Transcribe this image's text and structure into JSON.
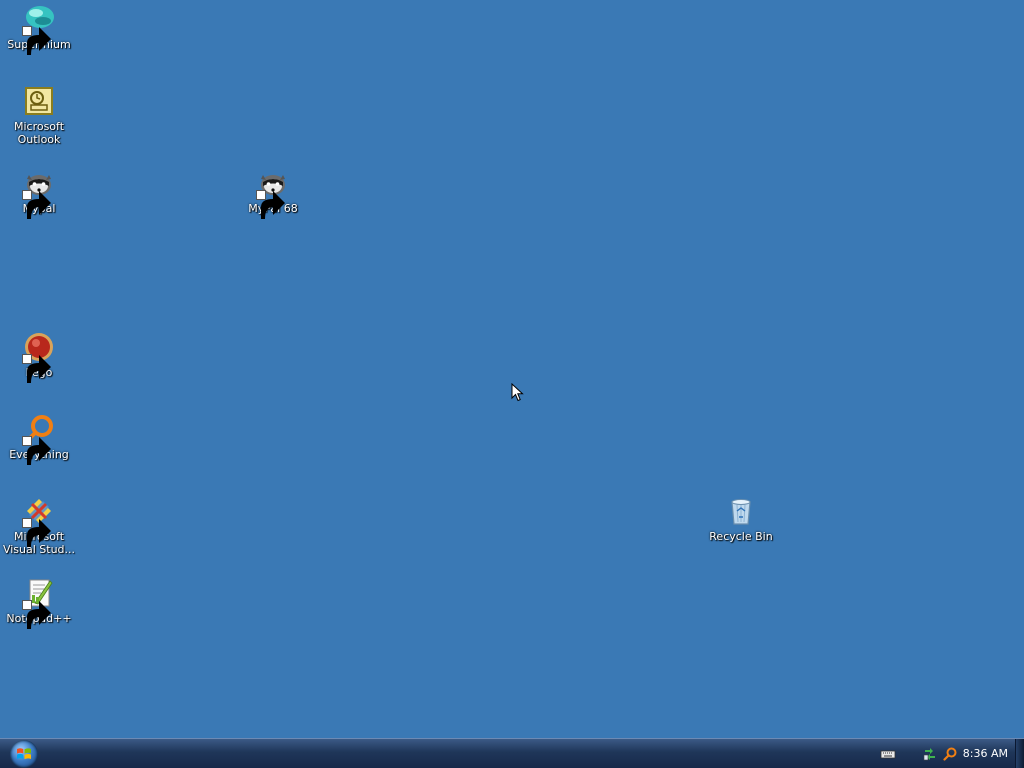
{
  "desktop": {
    "background_color": "#3a79b5",
    "icons": [
      {
        "label": "Supermium",
        "icon": "supermium-icon",
        "shortcut": true
      },
      {
        "label": "Microsoft\nOutlook",
        "icon": "outlook-icon",
        "shortcut": false
      },
      {
        "label": "Mypal",
        "icon": "mypal-icon",
        "shortcut": true
      },
      {
        "label": "MyPal 68",
        "icon": "mypal-icon",
        "shortcut": true
      },
      {
        "label": "Pego",
        "icon": "pego-icon",
        "shortcut": true
      },
      {
        "label": "Everything",
        "icon": "search-magnifier-icon",
        "shortcut": true
      },
      {
        "label": "Microsoft\nVisual Stud...",
        "icon": "visual-studio-icon",
        "shortcut": true
      },
      {
        "label": "Notepad++",
        "icon": "notepad-plus-plus-icon",
        "shortcut": true
      },
      {
        "label": "Recycle Bin",
        "icon": "recycle-bin-icon",
        "shortcut": false
      }
    ]
  },
  "taskbar": {
    "start_button": {
      "icon": "windows-logo-icon"
    },
    "tray": {
      "icons": [
        "keyboard-icon",
        "network-icon",
        "search-magnifier-icon"
      ],
      "clock": "8:36 AM"
    }
  }
}
